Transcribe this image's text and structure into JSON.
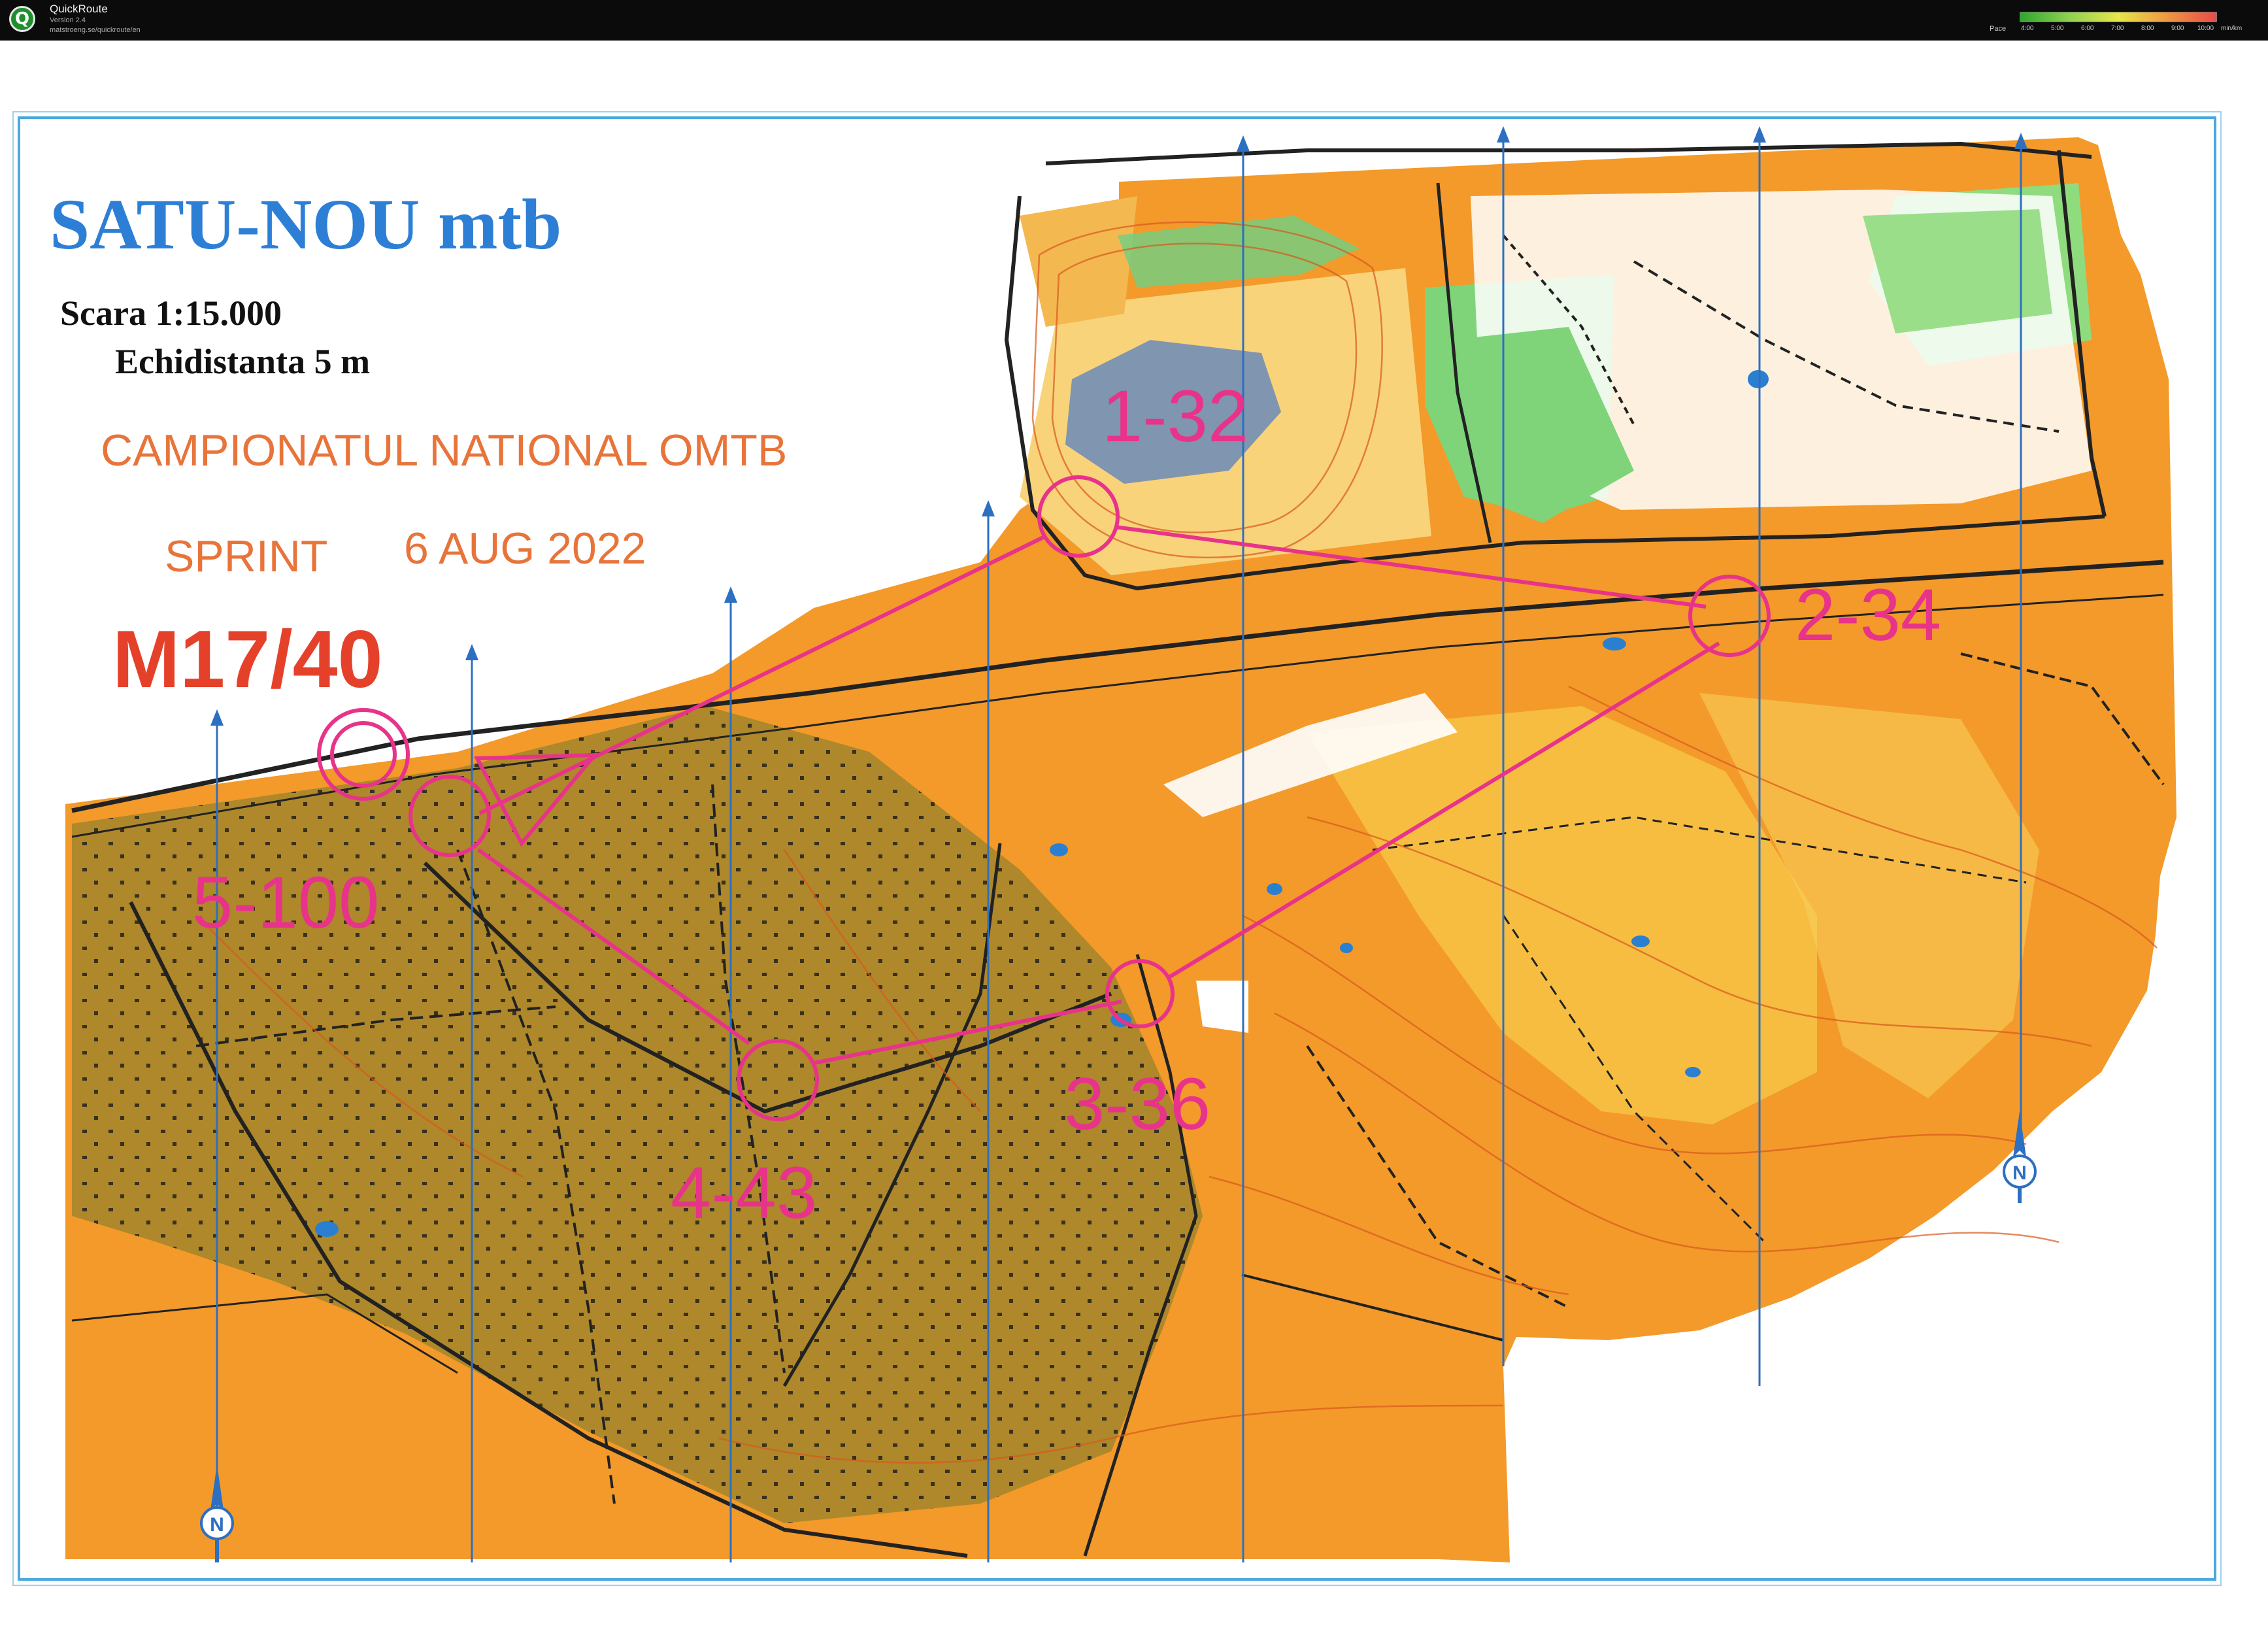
{
  "app": {
    "name": "QuickRoute",
    "version": "Version 2.4",
    "url": "matstroeng.se/quickroute/en",
    "icon": "quickroute-logo-icon",
    "pace_legend": {
      "label": "Pace",
      "ticks": [
        "4:00",
        "5:00",
        "6:00",
        "7:00",
        "8:00",
        "9:00",
        "10:00"
      ],
      "unit": "min/km",
      "colors": [
        "#2fa52f",
        "#8fd14f",
        "#e6e64a",
        "#f0a040",
        "#e84a4a"
      ]
    }
  },
  "map": {
    "title": "SATU-NOU mtb",
    "scale": "Scara 1:15.000",
    "contour_interval": "Echidistanta 5 m",
    "event": "CAMPIONATUL NATIONAL OMTB",
    "format": "SPRINT",
    "date": "6 AUG 2022",
    "course": "M17/40",
    "north_icon": "north-arrow-icon",
    "colors": {
      "course": "#e8338a",
      "title": "#2d7fd6",
      "event": "#e8743a",
      "course_code": "#e5412a",
      "frame": "#4aa8e0",
      "map_base": "#f39a2a",
      "village": "#a8872a",
      "forest_green": "#7fd47a"
    },
    "controls": [
      {
        "label": "1-32"
      },
      {
        "label": "2-34"
      },
      {
        "label": "3-36"
      },
      {
        "label": "4-43"
      },
      {
        "label": "5-100"
      }
    ]
  }
}
